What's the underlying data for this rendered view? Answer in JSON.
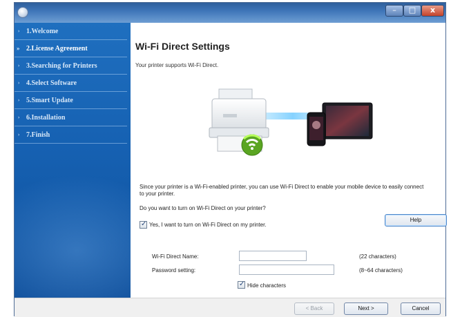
{
  "steps": [
    {
      "label": "1.Welcome",
      "arrow": "›"
    },
    {
      "label": "2.License Agreement",
      "arrow": "»"
    },
    {
      "label": "3.Searching for Printers",
      "arrow": "›"
    },
    {
      "label": "4.Select Software",
      "arrow": "›"
    },
    {
      "label": "5.Smart Update",
      "arrow": "›"
    },
    {
      "label": "6.Installation",
      "arrow": "›"
    },
    {
      "label": "7.Finish",
      "arrow": "›"
    }
  ],
  "active_step": "2.License Agreement",
  "content": {
    "title": "Wi-Fi Direct Settings",
    "subtitle": "Your printer supports Wi-Fi Direct.",
    "description": "Since your printer is a Wi-Fi-enabled printer, you can use Wi-Fi Direct to enable your mobile device to easily connect to your printer.",
    "question": "Do you want to turn on Wi-Fi Direct on your printer?",
    "enable_checkbox": {
      "label": "Yes, I want to turn on Wi-Fi Direct on my printer.",
      "checked": true
    },
    "help_label": "Help",
    "fields": {
      "name_label": "Wi-Fi Direct Name:",
      "name_value": "",
      "name_hint": "(22 characters)",
      "password_label": "Password setting:",
      "password_value": "",
      "password_hint": "(8~64 characters)"
    },
    "hide_checkbox": {
      "label": "Hide characters",
      "checked": true
    }
  },
  "footer": {
    "back_label": "< Back",
    "next_label": "Next >",
    "cancel_label": "Cancel"
  },
  "window_controls": {
    "minimize": "–",
    "maximize": "□",
    "close": "x"
  },
  "icons": [
    "app-icon",
    "printer-icon",
    "wifi-icon",
    "smartphone-icon",
    "tablet-icon",
    "checkbox-icon"
  ],
  "colors": {
    "sidebar": "#1661b2",
    "titlebar": "#3e75b8",
    "wifi_green": "#6fbe2c",
    "close_red": "#c3432a"
  }
}
